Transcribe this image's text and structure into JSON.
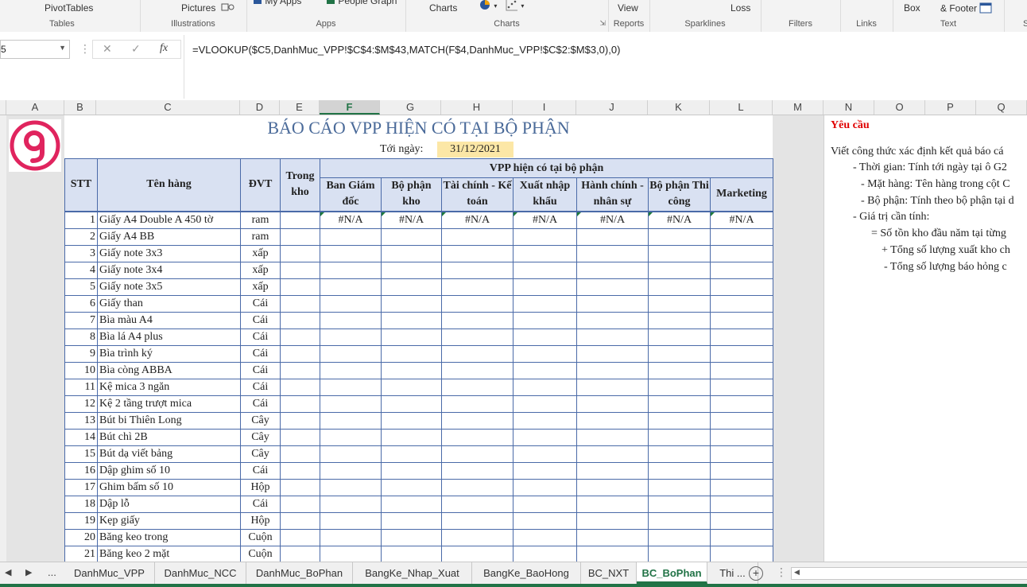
{
  "ribbon": {
    "groups": [
      {
        "top": "PivotTables",
        "label": "Tables"
      },
      {
        "top": "Pictures",
        "label": "Illustrations"
      },
      {
        "top": "My Apps",
        "top2": "People Graph",
        "label": "Apps"
      },
      {
        "top": "Charts",
        "label": "Charts"
      },
      {
        "top": "View",
        "label": "Reports"
      },
      {
        "top": "",
        "label": "Sparklines"
      },
      {
        "top": "Loss",
        "label": ""
      },
      {
        "top": "",
        "label": "Filters"
      },
      {
        "top": "",
        "label": "Links"
      },
      {
        "top": "Box",
        "top2": "& Footer",
        "label": "Text"
      },
      {
        "top": "",
        "label": "S"
      }
    ]
  },
  "formula_bar": {
    "name_box": "5",
    "formula": "=VLOOKUP($C5,DanhMuc_VPP!$C$4:$M$43,MATCH(F$4,DanhMuc_VPP!$C$2:$M$3,0),0)"
  },
  "columns": [
    "A",
    "B",
    "C",
    "D",
    "E",
    "F",
    "G",
    "H",
    "I",
    "J",
    "K",
    "L",
    "M",
    "N",
    "O",
    "P",
    "Q"
  ],
  "selected_column": "F",
  "report": {
    "title": "BÁO CÁO VPP HIỆN CÓ TẠI BỘ PHẬN",
    "date_label": "Tới ngày:",
    "date_value": "31/12/2021",
    "headers": {
      "stt": "STT",
      "name": "Tên hàng",
      "unit": "ĐVT",
      "stock": "Trong kho",
      "group": "VPP hiện có tại bộ phận",
      "departments": [
        "Ban Giám đốc",
        "Bộ phận kho",
        "Tài chính - Kế toán",
        "Xuất nhập khẩu",
        "Hành chính - nhân sự",
        "Bộ phận Thi công",
        "Marketing"
      ]
    },
    "rows": [
      {
        "stt": "1",
        "name": "Giấy A4 Double A 450 tờ",
        "unit": "ram",
        "values": [
          "#N/A",
          "#N/A",
          "#N/A",
          "#N/A",
          "#N/A",
          "#N/A",
          "#N/A"
        ]
      },
      {
        "stt": "2",
        "name": "Giấy A4 BB",
        "unit": "ram"
      },
      {
        "stt": "3",
        "name": "Giấy note 3x3",
        "unit": "xấp"
      },
      {
        "stt": "4",
        "name": "Giấy note 3x4",
        "unit": "xấp"
      },
      {
        "stt": "5",
        "name": "Giấy note 3x5",
        "unit": "xấp"
      },
      {
        "stt": "6",
        "name": "Giấy than",
        "unit": "Cái"
      },
      {
        "stt": "7",
        "name": "Bìa màu A4",
        "unit": "Cái"
      },
      {
        "stt": "8",
        "name": "Bìa lá A4 plus",
        "unit": "Cái"
      },
      {
        "stt": "9",
        "name": "Bìa trình ký",
        "unit": "Cái"
      },
      {
        "stt": "10",
        "name": "Bìa còng ABBA",
        "unit": "Cái"
      },
      {
        "stt": "11",
        "name": "Kệ mica 3 ngăn",
        "unit": "Cái"
      },
      {
        "stt": "12",
        "name": "Kệ 2 tầng trượt mica",
        "unit": "Cái"
      },
      {
        "stt": "13",
        "name": "Bút bi Thiên Long",
        "unit": "Cây"
      },
      {
        "stt": "14",
        "name": "Bút chì 2B",
        "unit": "Cây"
      },
      {
        "stt": "15",
        "name": "Bút dạ viết bảng",
        "unit": "Cây"
      },
      {
        "stt": "16",
        "name": "Dập ghim số 10",
        "unit": "Cái"
      },
      {
        "stt": "17",
        "name": "Ghim bấm số 10",
        "unit": "Hộp"
      },
      {
        "stt": "18",
        "name": "Dập lỗ",
        "unit": "Cái"
      },
      {
        "stt": "19",
        "name": "Kẹp giấy",
        "unit": "Hộp"
      },
      {
        "stt": "20",
        "name": "Băng keo trong",
        "unit": "Cuộn"
      },
      {
        "stt": "21",
        "name": "Băng keo 2 mặt",
        "unit": "Cuộn"
      }
    ]
  },
  "notes": {
    "heading": "Yêu cầu",
    "lines": [
      "Viết công thức xác định kết quả báo cá",
      "- Thời gian: Tính tới ngày tại ô G2",
      "- Mặt hàng: Tên hàng trong cột C",
      "- Bộ phận: Tính theo bộ phận tại d",
      "- Giá trị cần tính:",
      "= Số tồn kho đầu năm tại từng",
      "+ Tổng số lượng xuất kho ch",
      "- Tổng số lượng báo hỏng c"
    ]
  },
  "sheet_tabs": {
    "ellipsis": "...",
    "tabs": [
      "DanhMuc_VPP",
      "DanhMuc_NCC",
      "DanhMuc_BoPhan",
      "BangKe_Nhap_Xuat",
      "BangKe_BaoHong",
      "BC_NXT",
      "BC_BoPhan",
      "Thi ..."
    ],
    "active": "BC_BoPhan"
  },
  "colors": {
    "excel_green": "#217346",
    "header_fill": "#d9e1f2",
    "date_fill": "#fce7a6",
    "title_color": "#4a6a99",
    "requirement_red": "#e00000"
  }
}
